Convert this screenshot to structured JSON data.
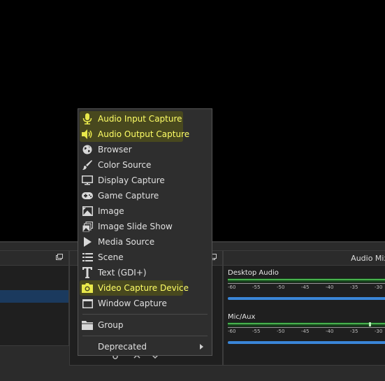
{
  "add_source_menu": {
    "items": [
      {
        "label": "Audio Input Capture",
        "icon": "microphone-icon",
        "highlighted": true
      },
      {
        "label": "Audio Output Capture",
        "icon": "speaker-icon",
        "highlighted": true
      },
      {
        "label": "Browser",
        "icon": "globe-icon",
        "highlighted": false
      },
      {
        "label": "Color Source",
        "icon": "brush-icon",
        "highlighted": false
      },
      {
        "label": "Display Capture",
        "icon": "monitor-icon",
        "highlighted": false
      },
      {
        "label": "Game Capture",
        "icon": "gamepad-icon",
        "highlighted": false
      },
      {
        "label": "Image",
        "icon": "image-icon",
        "highlighted": false
      },
      {
        "label": "Image Slide Show",
        "icon": "slideshow-icon",
        "highlighted": false
      },
      {
        "label": "Media Source",
        "icon": "play-icon",
        "highlighted": false
      },
      {
        "label": "Scene",
        "icon": "list-icon",
        "highlighted": false
      },
      {
        "label": "Text (GDI+)",
        "icon": "text-icon",
        "highlighted": false
      },
      {
        "label": "Video Capture Device",
        "icon": "camera-icon",
        "highlighted": true
      },
      {
        "label": "Window Capture",
        "icon": "window-icon",
        "highlighted": false
      }
    ],
    "group": {
      "label": "Group",
      "icon": "folder-icon"
    },
    "deprecated": {
      "label": "Deprecated"
    }
  },
  "audio_mixer": {
    "title": "Audio Mix",
    "channels": [
      {
        "name": "Desktop Audio",
        "ticks": [
          "-60",
          "-55",
          "-50",
          "-45",
          "-40",
          "-35",
          "-30"
        ]
      },
      {
        "name": "Mic/Aux",
        "ticks": [
          "-60",
          "-55",
          "-50",
          "-45",
          "-40",
          "-35",
          "-30"
        ]
      }
    ]
  },
  "colors": {
    "highlight_text": "#ffff66",
    "highlight_bg": "#4a4a1e",
    "meter_green": "#49b34f",
    "fader_blue": "#3a86d8",
    "selection_blue": "#1b3a5e"
  }
}
